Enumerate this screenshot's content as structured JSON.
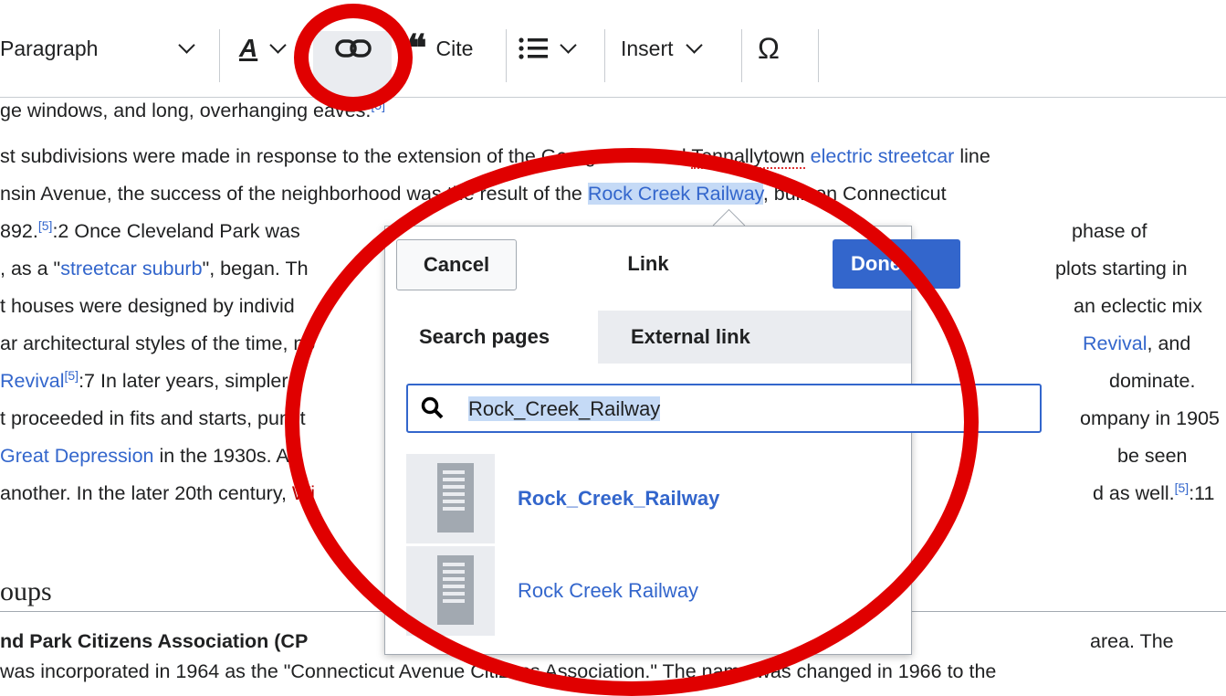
{
  "toolbar": {
    "paragraph_label": "Paragraph",
    "cite_label": "Cite",
    "insert_label": "Insert",
    "special_char": "Ω"
  },
  "article": {
    "line0": "ge windows, and long, overhanging eaves.",
    "line0_ref": "[5]",
    "line1_a": "st subdivisions were made in response to the extension of the Georgetown and ",
    "line1_b": "Tennallytown",
    "line1_c": "electric streetcar",
    "line1_d": " line",
    "line2_a": "nsin Avenue, the success of the neighborhood was the result of the ",
    "line2_link": "Rock Creek Railway",
    "line2_c": ", built on Connecticut",
    "line3_a": "892.",
    "line3_ref": "[5]",
    "line3_b": ":2  Once Cleveland Park was",
    "line3_c": "phase of",
    "line4_a": ", as a \"",
    "line4_link": "streetcar suburb",
    "line4_b": "\", began. Th",
    "line4_c": "plots starting in",
    "line5_a": "t houses were designed by individ",
    "line5_c": "an eclectic mix",
    "line6_a": "ar architectural styles of the time, no",
    "line6_link": "Revival",
    "line6_c": ", and",
    "line7_link": "Revival",
    "line7_ref": "[5]",
    "line7_b": ":7 In later years, simpler s",
    "line7_c": "dominate.",
    "line8_a": "t proceeded in fits and starts, punct",
    "line8_c": "ompany in 1905",
    "line9_link": "Great Depression",
    "line9_b": " in the 1930s. As",
    "line9_c": "be seen",
    "line10_a": "another. In the later 20th century, ",
    "line10_link": "Wi",
    "line10_c": "d as well.",
    "line10_ref": "[5]",
    "line10_d": ":11",
    "heading": "oups",
    "line11_a": "nd Park Citizens Association (CP",
    "line11_c": "area. The",
    "line12": "was incorporated in 1964 as the \"Connecticut Avenue Citizens Association.\" The name was changed in 1966 to the"
  },
  "dialog": {
    "cancel_label": "Cancel",
    "title": "Link",
    "done_label": "Done",
    "tabs": [
      "Search pages",
      "External link"
    ],
    "search_value": "Rock_Creek_Railway",
    "results": [
      {
        "label": "Rock_Creek_Railway",
        "bold": true
      },
      {
        "label": "Rock Creek Railway",
        "bold": false
      }
    ]
  },
  "colors": {
    "link": "#3366cc",
    "redlink": "#ba0000",
    "highlight": "#c5daf6",
    "annotation": "#e00000",
    "primary_button": "#3366cc"
  },
  "icons": [
    "chevron-down-icon",
    "text-style-icon",
    "link-icon",
    "quote-icon",
    "list-icon",
    "search-icon",
    "page-icon"
  ]
}
